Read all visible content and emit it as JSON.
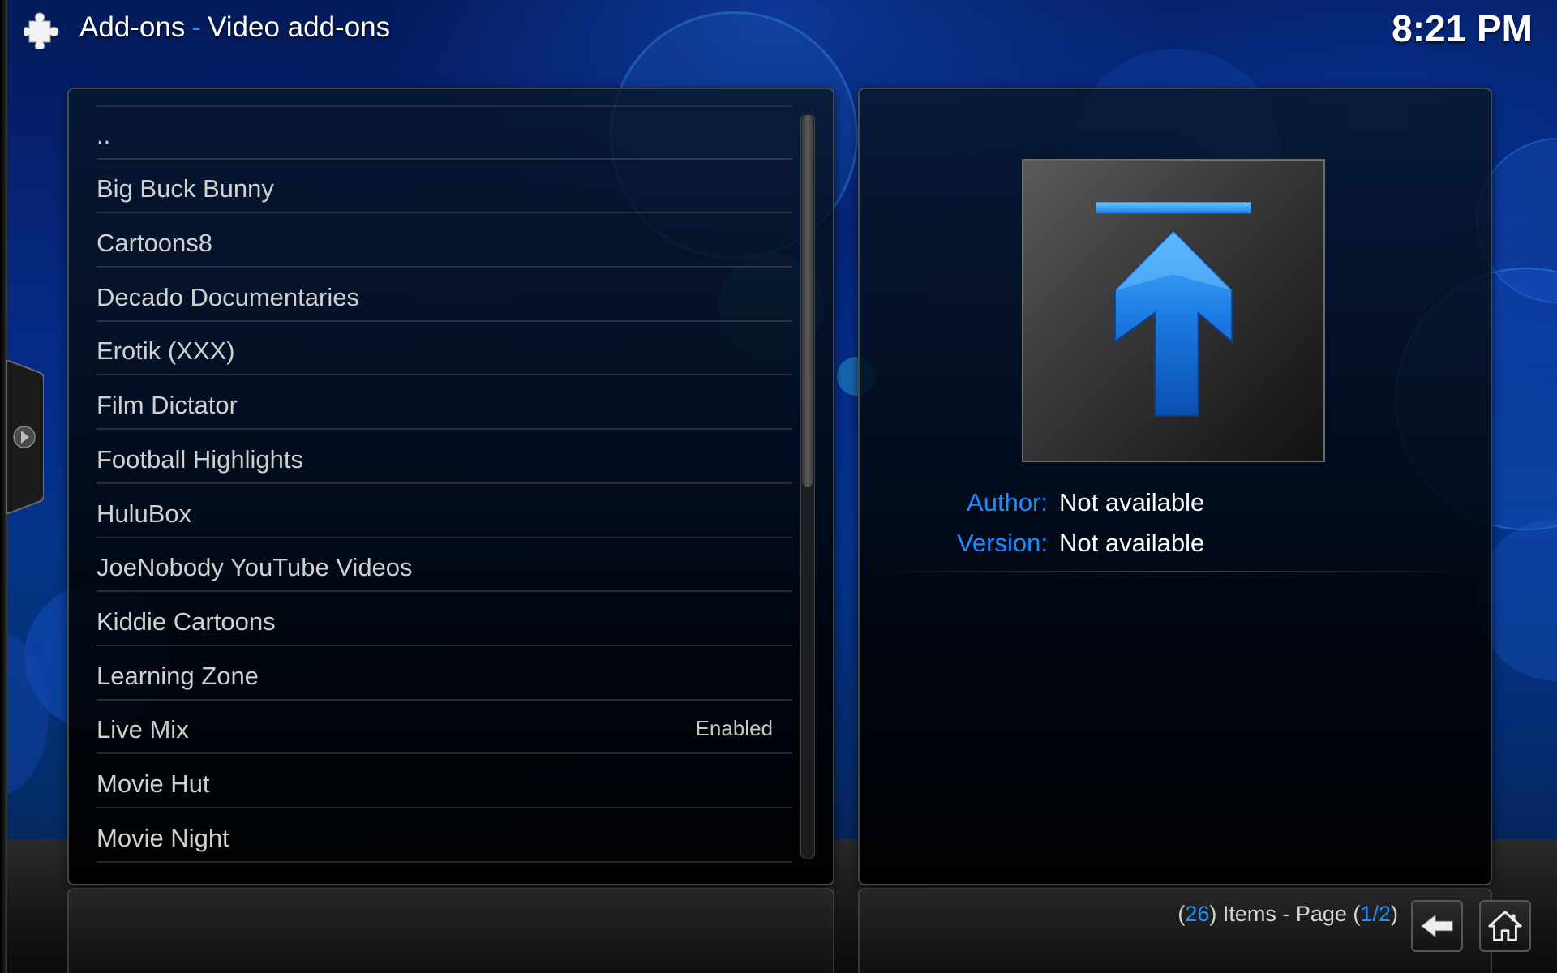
{
  "header": {
    "section": "Add-ons",
    "separator": "-",
    "subsection": "Video add-ons",
    "clock": "8:21 PM"
  },
  "addon_list": {
    "items": [
      {
        "label": "..",
        "status": ""
      },
      {
        "label": "Big Buck Bunny",
        "status": ""
      },
      {
        "label": "Cartoons8",
        "status": ""
      },
      {
        "label": "Decado Documentaries",
        "status": ""
      },
      {
        "label": "Erotik (XXX)",
        "status": ""
      },
      {
        "label": "Film Dictator",
        "status": ""
      },
      {
        "label": "Football Highlights",
        "status": ""
      },
      {
        "label": "HuluBox",
        "status": ""
      },
      {
        "label": "JoeNobody YouTube Videos",
        "status": ""
      },
      {
        "label": "Kiddie Cartoons",
        "status": ""
      },
      {
        "label": "Learning Zone",
        "status": ""
      },
      {
        "label": "Live Mix",
        "status": "Enabled"
      },
      {
        "label": "Movie Hut",
        "status": ""
      },
      {
        "label": "Movie Night",
        "status": ""
      }
    ],
    "scroll_position_fraction": 0.0,
    "scroll_visible_fraction": 0.5
  },
  "details": {
    "icon": "parent-folder-up-arrow-icon",
    "author_label": "Author:",
    "author_value": "Not available",
    "version_label": "Version:",
    "version_value": "Not available"
  },
  "footer": {
    "paren_open": "(",
    "item_count": "26",
    "items_text": ") Items - Page (",
    "current_page": "1",
    "page_sep": "/",
    "total_pages": "2",
    "paren_close": ")",
    "back_icon": "back-arrow-icon",
    "home_icon": "home-icon"
  },
  "colors": {
    "accent": "#1e90ff",
    "text_primary": "#ffffff",
    "text_list": "#d0d0d0"
  }
}
